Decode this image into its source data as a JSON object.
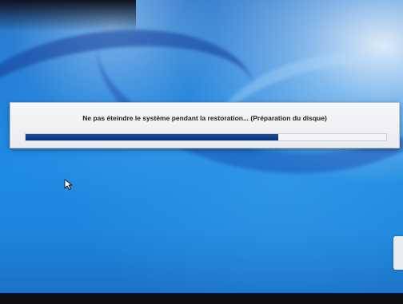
{
  "dialog": {
    "message": "Ne pas éteindre le système pendant la restoration... (Préparation du disque)",
    "progress": 0.7
  },
  "colors": {
    "progress_fill": "#0f3d86",
    "dialog_bg": "#eef0f2",
    "desktop_blue": "#1f8be2"
  },
  "icons": {
    "cursor": "mouse-pointer-icon"
  }
}
